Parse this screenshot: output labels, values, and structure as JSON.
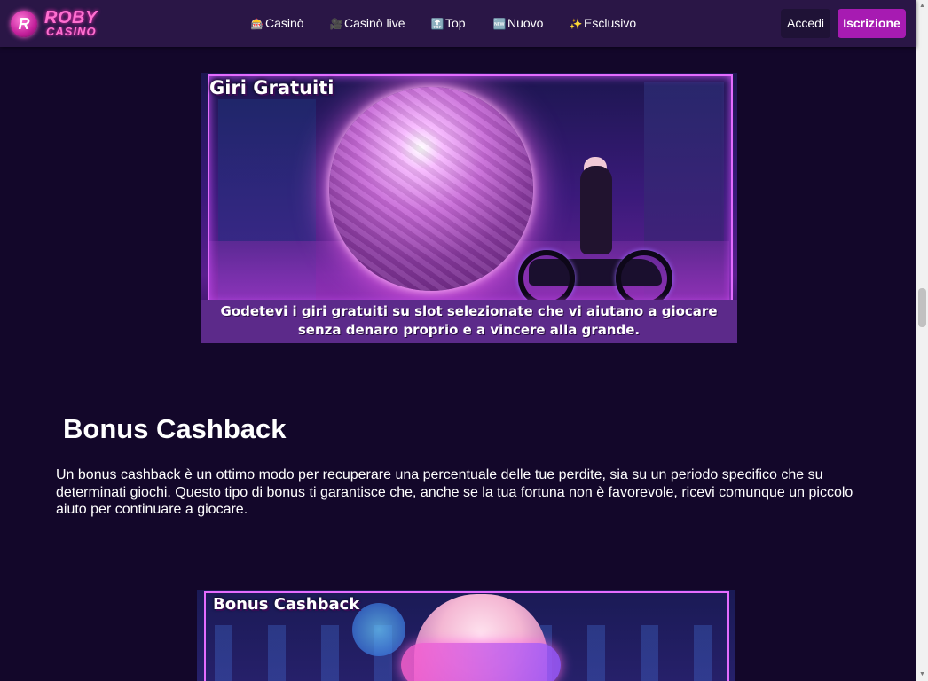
{
  "header": {
    "logo": {
      "word": "ROBY",
      "sub": "CASINO",
      "badge": "R"
    },
    "nav": [
      {
        "icon": "slot-machine-icon",
        "glyph": "🎰",
        "label": "Casinò"
      },
      {
        "icon": "video-camera-icon",
        "glyph": "🎥",
        "label": "Casinò live"
      },
      {
        "icon": "top-arrow-icon",
        "glyph": "🔝",
        "label": "Top"
      },
      {
        "icon": "new-badge-icon",
        "glyph": "🆕",
        "label": "Nuovo"
      },
      {
        "icon": "sparkles-icon",
        "glyph": "✨",
        "label": "Esclusivo"
      }
    ],
    "login_label": "Accedi",
    "signup_label": "Iscrizione"
  },
  "banner_free_spins": {
    "title": "Giri Gratuiti",
    "caption_line1": "Godetevi i giri gratuiti su slot selezionate che vi aiutano a giocare",
    "caption_line2": "senza denaro proprio e a vincere alla grande."
  },
  "cashback": {
    "heading": "Bonus Cashback",
    "text": "Un bonus cashback è un ottimo modo per recuperare una percentuale delle tue perdite, sia su un periodo specifico che su determinati giochi. Questo tipo di bonus ti garantisce che, anche se la tua fortuna non è favorevole, ricevi comunque un piccolo aiuto per continuare a giocare."
  },
  "banner_cashback": {
    "title": "Bonus Cashback"
  },
  "colors": {
    "page_bg": "#13072a",
    "header_bg": "#2a1646",
    "signup_bg": "#a71bb2",
    "logo_pink": "#ff6fd0"
  },
  "scrollbar": {
    "up_glyph": "▲",
    "down_glyph": "▼"
  }
}
